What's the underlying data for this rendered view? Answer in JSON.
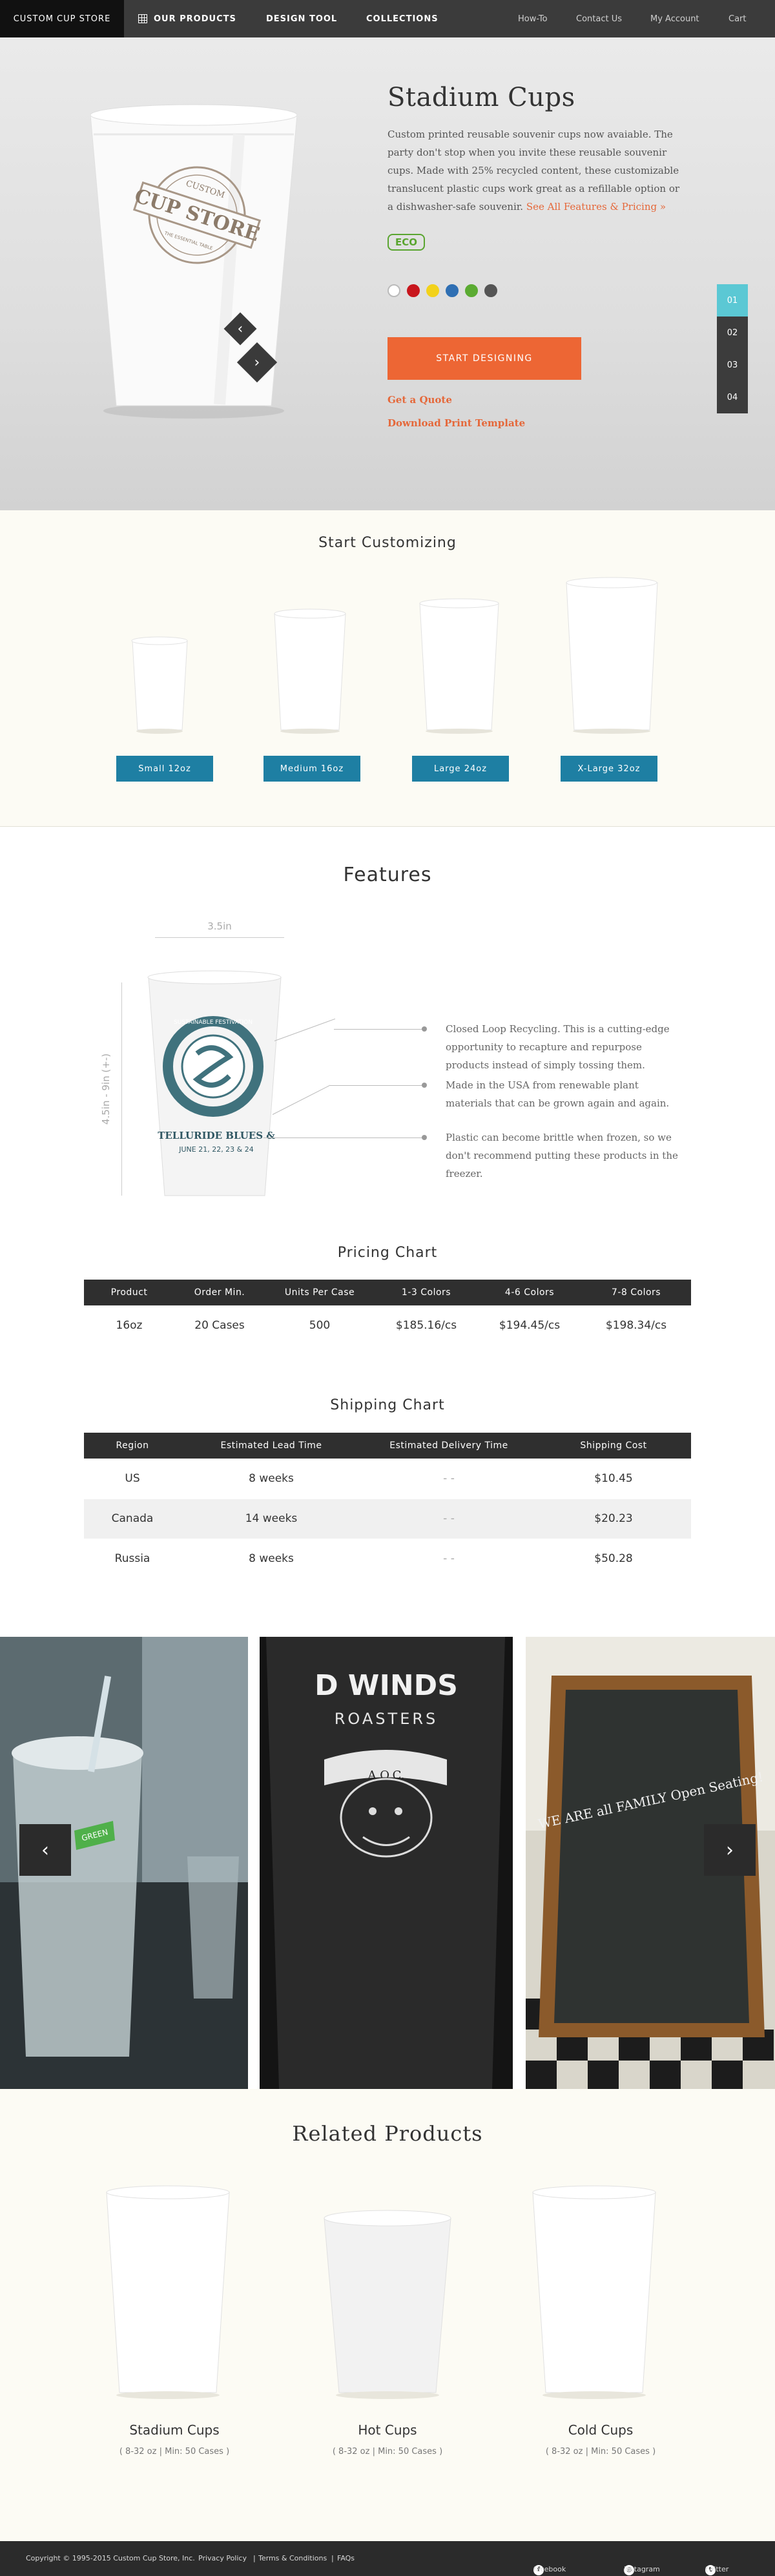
{
  "nav": {
    "brand": "CUSTOM CUP STORE",
    "items": [
      "OUR PRODUCTS",
      "DESIGN TOOL",
      "COLLECTIONS"
    ],
    "right": [
      "How-To",
      "Contact Us",
      "My Account",
      "Cart"
    ]
  },
  "hero": {
    "title": "Stadium Cups",
    "description": "Custom printed reusable souvenir cups now avaiable. The party don't stop when you invite these reusable souvenir cups. Made with 25% recycled content, these customizable translucent plastic cups work great as a refillable option or a dishwasher-safe souvenir.",
    "see_all": "See All Features & Pricing »",
    "eco_label": "ECO",
    "cup_logo": {
      "top": "CUSTOM",
      "main": "CUP STORE",
      "bottom": "THE ESSENTIAL TABLE"
    },
    "swatch_colors": [
      "#ffffff",
      "#c8161d",
      "#f2d21b",
      "#2f6fb3",
      "#5bab32",
      "#555555"
    ],
    "design_button": "START DESIGNING",
    "get_quote": "Get a Quote",
    "download": "Download Print Template",
    "slides": [
      "01",
      "02",
      "03",
      "04"
    ],
    "prev_symbol": "‹",
    "next_symbol": "›"
  },
  "customizing": {
    "title": "Start Customizing",
    "sizes": [
      "Small 12oz",
      "Medium 16oz",
      "Large 24oz",
      "X-Large 32oz"
    ]
  },
  "features": {
    "title": "Features",
    "width_label": "3.5in",
    "height_label": "4.5in - 9in (+-)",
    "cup_print": {
      "ring": "SUSTAINABLE FESTIVATION",
      "event": "TELLURIDE BLUES &",
      "dates": "JUNE 21, 22, 23 & 24"
    },
    "items": [
      "Closed Loop Recycling. This is a cutting-edge opportunity to recapture and repurpose products instead of simply tossing them.",
      "Made in the USA from renewable plant materials that can be grown again and again.",
      "Plastic can become brittle when frozen, so we don't recommend putting these products in the freezer."
    ]
  },
  "pricing": {
    "title": "Pricing Chart",
    "headers": [
      "Product",
      "Order Min.",
      "Units Per Case",
      "1-3 Colors",
      "4-6 Colors",
      "7-8 Colors"
    ],
    "rows": [
      [
        "16oz",
        "20 Cases",
        "500",
        "$185.16/cs",
        "$194.45/cs",
        "$198.34/cs"
      ]
    ]
  },
  "shipping": {
    "title": "Shipping Chart",
    "headers": [
      "Region",
      "Estimated Lead Time",
      "Estimated Delivery Time",
      "Shipping Cost"
    ],
    "rows": [
      [
        "US",
        "8 weeks",
        "- -",
        "$10.45"
      ],
      [
        "Canada",
        "14 weeks",
        "- -",
        "$20.23"
      ],
      [
        "Russia",
        "8 weeks",
        "- -",
        "$50.28"
      ]
    ]
  },
  "gallery": {
    "prev_symbol": "‹",
    "next_symbol": "›",
    "photos": [
      {
        "alt": "Clear plastic cup with lid and straw",
        "text": "GREEN"
      },
      {
        "alt": "Black printed cup",
        "text": "D WINDS",
        "sub": "ROASTERS",
        "mark": "A.O.C."
      },
      {
        "alt": "Chalkboard sign",
        "text": "WE ARE all FAMILY Open Seating!"
      }
    ]
  },
  "related": {
    "title": "Related Products",
    "items": [
      {
        "name": "Stadium Cups",
        "sub": "( 8-32 oz | Min: 50 Cases )"
      },
      {
        "name": "Hot Cups",
        "sub": "( 8-32 oz | Min: 50 Cases )"
      },
      {
        "name": "Cold Cups",
        "sub": "( 8-32 oz | Min: 50 Cases )"
      }
    ]
  },
  "footer": {
    "copyright": "Copyright © 1995-2015 Custom Cup Store, Inc.",
    "links": [
      "Privacy Policy",
      "Terms & Conditions",
      "FAQs"
    ],
    "social": [
      "facebook",
      "instagram",
      "twitter"
    ]
  }
}
